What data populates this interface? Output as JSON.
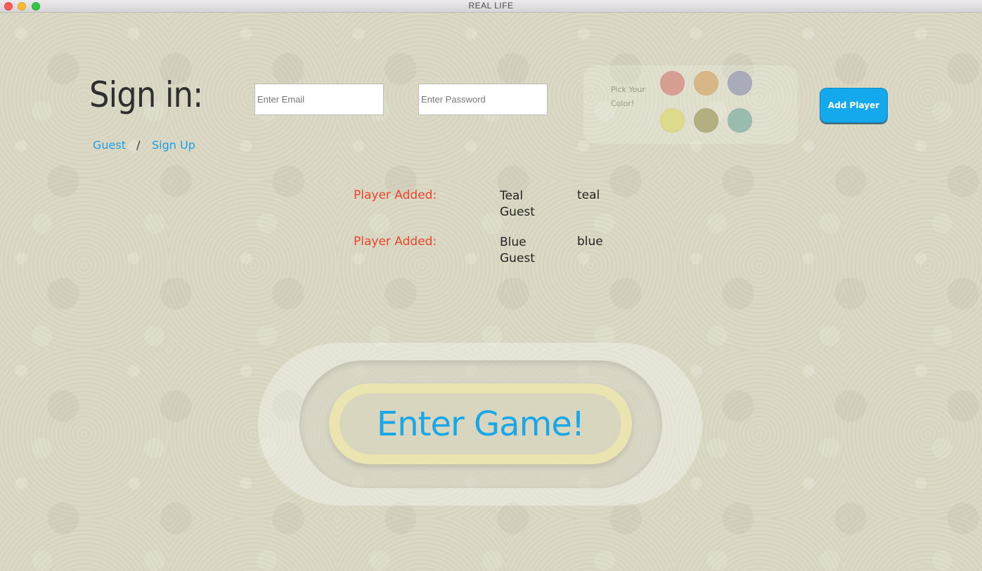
{
  "window": {
    "title": "REAL LIFE"
  },
  "signin": {
    "title": "Sign in:",
    "guest_link": "Guest",
    "separator": "/",
    "signup_link": "Sign Up",
    "email_placeholder": "Enter Email",
    "email_value": "",
    "password_placeholder": "Enter Password",
    "password_value": ""
  },
  "color_picker": {
    "label": "Pick Your Color!",
    "swatches": [
      {
        "name": "red",
        "color": "#d69f91"
      },
      {
        "name": "orange",
        "color": "#d8b787"
      },
      {
        "name": "blue",
        "color": "#a9abba"
      },
      {
        "name": "yellow",
        "color": "#dcdb8c"
      },
      {
        "name": "olive",
        "color": "#b2af80"
      },
      {
        "name": "teal",
        "color": "#98bcae"
      }
    ]
  },
  "add_player_button": "Add Player",
  "players": [
    {
      "label": "Player Added:",
      "name": "Teal Guest",
      "color": "teal"
    },
    {
      "label": "Player Added:",
      "name": "Blue Guest",
      "color": "blue"
    }
  ],
  "enter_game_button": "Enter Game!",
  "colors": {
    "accent": "#18a8ea",
    "player_label": "#e8442e",
    "button_fill": "#e9e4b0"
  }
}
